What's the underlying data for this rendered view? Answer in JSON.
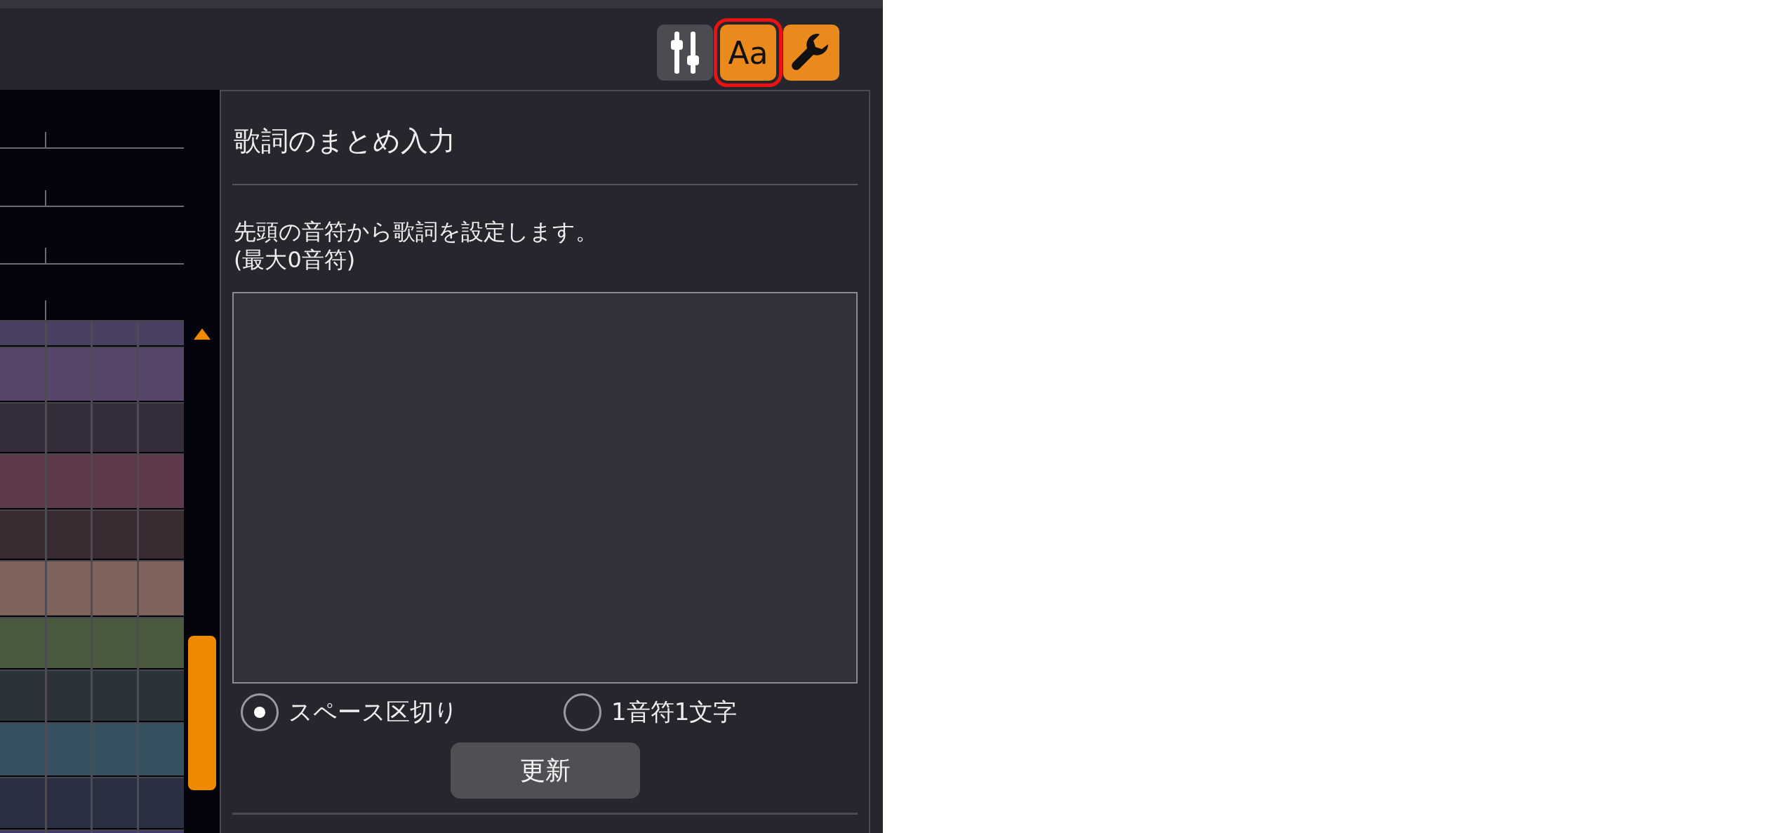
{
  "toolbar": {
    "tools": [
      {
        "kind": "sliders",
        "active": false,
        "highlighted": false
      },
      {
        "kind": "text",
        "label": "Aa",
        "active": true,
        "highlighted": true
      },
      {
        "kind": "wrench",
        "active": true,
        "highlighted": false
      }
    ]
  },
  "panel": {
    "title": "歌詞のまとめ入力",
    "description": [
      "先頭の音符から歌詞を設定します。",
      "(最大0音符)"
    ],
    "modes": [
      {
        "label": "スペース区切り",
        "selected": true
      },
      {
        "label": "1音符1文字",
        "selected": false
      }
    ],
    "button": "更新"
  }
}
